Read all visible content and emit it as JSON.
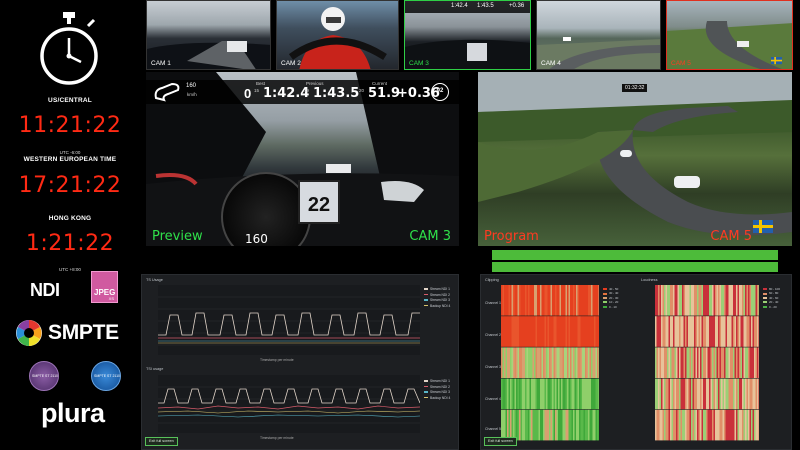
{
  "clocks": [
    {
      "city": "US/CENTRAL",
      "utc": "",
      "time": "11:21:22"
    },
    {
      "city": "WESTERN EUROPEAN TIME",
      "utc": "UTC -6:00",
      "time": "17:21:22"
    },
    {
      "city": "HONG KONG",
      "utc": "",
      "time": "1:21:22"
    }
  ],
  "utc_after_hk": "UTC +8:00",
  "logos": {
    "ndi": "NDI",
    "jpeg": "JPEG",
    "jpeg_sub": "XS",
    "smpte": "SMPTE",
    "badge_a": "SMPTE ST 2110",
    "badge_b": "SMPTE ST 2110",
    "plura": "plura"
  },
  "cameras": [
    {
      "label": "CAM 1"
    },
    {
      "label": "CAM 2"
    },
    {
      "label": "CAM 3"
    },
    {
      "label": "CAM 4"
    },
    {
      "label": "CAM 5"
    }
  ],
  "thumb3_hud": {
    "lap": "1:42.4",
    "prev": "1:43.5",
    "delta": "+0.36"
  },
  "preview": {
    "label": "Preview",
    "cam": "CAM 3",
    "speed": "160",
    "speed_unit": "km/h",
    "gear": "0",
    "best_label": "Best",
    "best": "1:42.4",
    "previous_label": "Previous",
    "previous": "1:43.5",
    "current_label": "Current",
    "current": "51.9",
    "delta": "+0.36",
    "lap_no": "92",
    "best_idx": "15",
    "prev_idx": "19",
    "cur_idx": "20",
    "gauge_value": "160",
    "car_number": "22"
  },
  "program": {
    "label": "Program",
    "cam": "CAM 5",
    "timecode": "01:32:32"
  },
  "panel_ts": {
    "title_top": "TS Usage",
    "title_bottom": "TSI usage",
    "y_axis": "TS Usage",
    "x_axis_top": "Timestamp per minute",
    "x_axis_bottom": "Timestamp per minute",
    "legend_top": [
      "Stream NDI 1",
      "Stream NDI 2",
      "Stream NDI 3",
      "Backup NDI 4"
    ],
    "legend_bottom": [
      "Stream NDI 1",
      "Stream NDI 2",
      "Stream NDI 3",
      "Backup NDI 4"
    ],
    "footer": "Exit full screen"
  },
  "panel_heat": {
    "title_left": "Clipping",
    "title_right": "Loudness",
    "rows": [
      "Channel 1",
      "Channel 2",
      "Channel 3",
      "Channel 4",
      "Channel 5"
    ],
    "legend_left": [
      "40 - 50",
      "30 - 40",
      "20 - 30",
      "10 - 20",
      "0 - 10"
    ],
    "legend_right": [
      "80 - 100",
      "60 - 80",
      "40 - 60",
      "20 - 40",
      "0 - 20"
    ],
    "footer": "Exit full screen"
  },
  "colors": {
    "clock_red": "#ff2a14",
    "preview_green": "#2fe04a",
    "program_red": "#ff3b22",
    "audio_green": "#4dbb3a"
  }
}
